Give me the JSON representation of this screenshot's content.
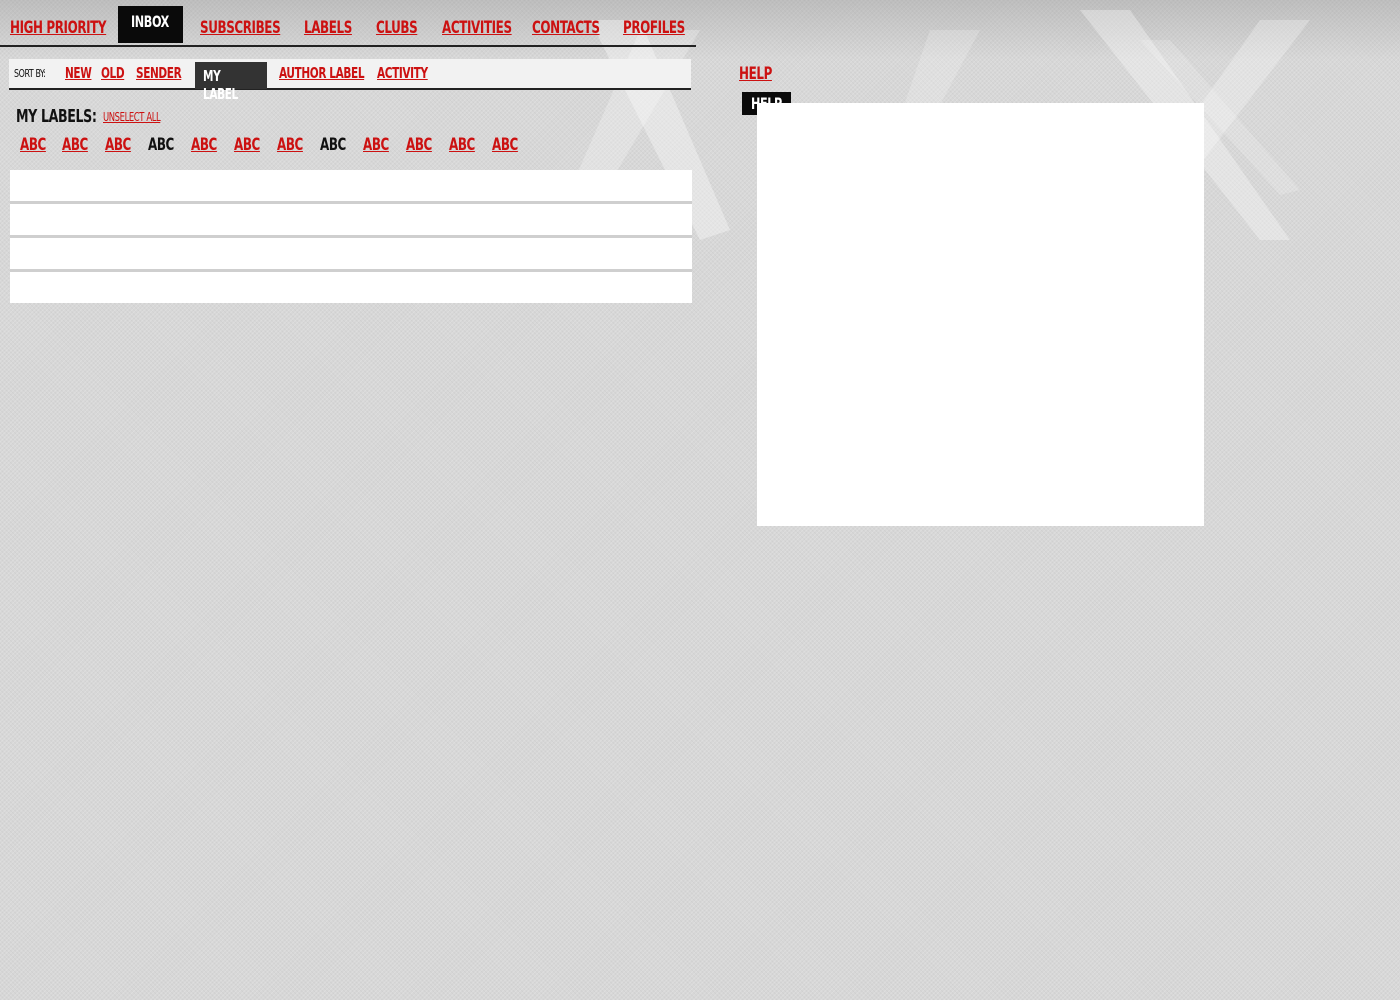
{
  "topnav": {
    "items": [
      {
        "label": "HIGH PRIORITY"
      },
      {
        "label": "INBOX",
        "active": true
      },
      {
        "label": "SUBSCRIBES"
      },
      {
        "label": "LABELS"
      },
      {
        "label": "CLUBS"
      },
      {
        "label": "ACTIVITIES"
      },
      {
        "label": "CONTACTS"
      },
      {
        "label": "PROFILES"
      }
    ]
  },
  "sort": {
    "label": "SORT BY:",
    "options": [
      "NEW",
      "OLD",
      "SENDER",
      "MY LABEL",
      "AUTHOR LABEL",
      "ACTIVITY"
    ],
    "selected": "MY LABEL"
  },
  "my_labels": {
    "title": "MY LABELS:",
    "unselect_all": "UNSELECT ALL",
    "items": [
      {
        "label": "ABC",
        "selected": true
      },
      {
        "label": "ABC",
        "selected": true
      },
      {
        "label": "ABC",
        "selected": true
      },
      {
        "label": "ABC",
        "selected": false
      },
      {
        "label": "ABC",
        "selected": true
      },
      {
        "label": "ABC",
        "selected": true
      },
      {
        "label": "ABC",
        "selected": true
      },
      {
        "label": "ABC",
        "selected": false
      },
      {
        "label": "ABC",
        "selected": true
      },
      {
        "label": "ABC",
        "selected": true
      },
      {
        "label": "ABC",
        "selected": true
      },
      {
        "label": "ABC",
        "selected": true
      }
    ]
  },
  "help": {
    "link_label": "HELP",
    "tab_label": "HELP"
  },
  "colors": {
    "accent": "#cc1111",
    "active_tab": "#0a0a0a",
    "background": "#d7d7d7"
  }
}
